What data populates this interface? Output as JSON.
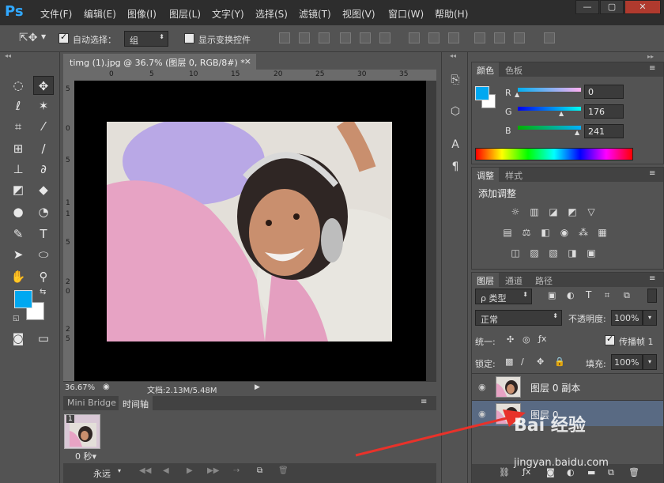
{
  "app": {
    "logo": "Ps",
    "menu": [
      "文件(F)",
      "编辑(E)",
      "图像(I)",
      "图层(L)",
      "文字(Y)",
      "选择(S)",
      "滤镜(T)",
      "视图(V)",
      "窗口(W)",
      "帮助(H)"
    ],
    "window_controls": [
      "—",
      "▢",
      "✕"
    ]
  },
  "options": {
    "auto_select_label": "自动选择：",
    "auto_select_value": "组",
    "show_transform_label": "显示变换控件"
  },
  "document": {
    "tab_title": "timg (1).jpg @ 36.7% (图层 0, RGB/8#) *",
    "tab_close": "×",
    "ruler_top": [
      "0",
      "5",
      "10",
      "15",
      "20",
      "25",
      "30",
      "35"
    ],
    "ruler_left": [
      "5",
      "0",
      "5",
      "1",
      "1",
      "5",
      "2",
      "0",
      "2",
      "5"
    ],
    "zoom": "36.67%",
    "doc_info": "文档:2.13M/5.48M"
  },
  "timeline": {
    "tabs": [
      "Mini Bridge",
      "时间轴"
    ],
    "frame_number": "1",
    "frame_delay": "0 秒▾",
    "loop": "永远"
  },
  "color_panel": {
    "tabs": [
      "颜色",
      "色板"
    ],
    "fg_color": "#00a8f1",
    "r_label": "R",
    "r_value": "0",
    "g_label": "G",
    "g_value": "176",
    "b_label": "B",
    "b_value": "241"
  },
  "adjust_panel": {
    "tabs": [
      "调整",
      "样式"
    ],
    "title": "添加调整"
  },
  "layers_panel": {
    "tabs": [
      "图层",
      "通道",
      "路径"
    ],
    "filter_label": "ρ 类型",
    "blend_mode": "正常",
    "opacity_label": "不透明度:",
    "opacity_value": "100%",
    "unify_label": "统一:",
    "propagate_label": "传播帧 1",
    "lock_label": "锁定:",
    "fill_label": "填充:",
    "fill_value": "100%",
    "layers": [
      {
        "name": "图层 0 副本"
      },
      {
        "name": "图层 0"
      }
    ]
  },
  "watermark": {
    "brand": "Bai 经验",
    "url": "jingyan.baidu.com"
  }
}
